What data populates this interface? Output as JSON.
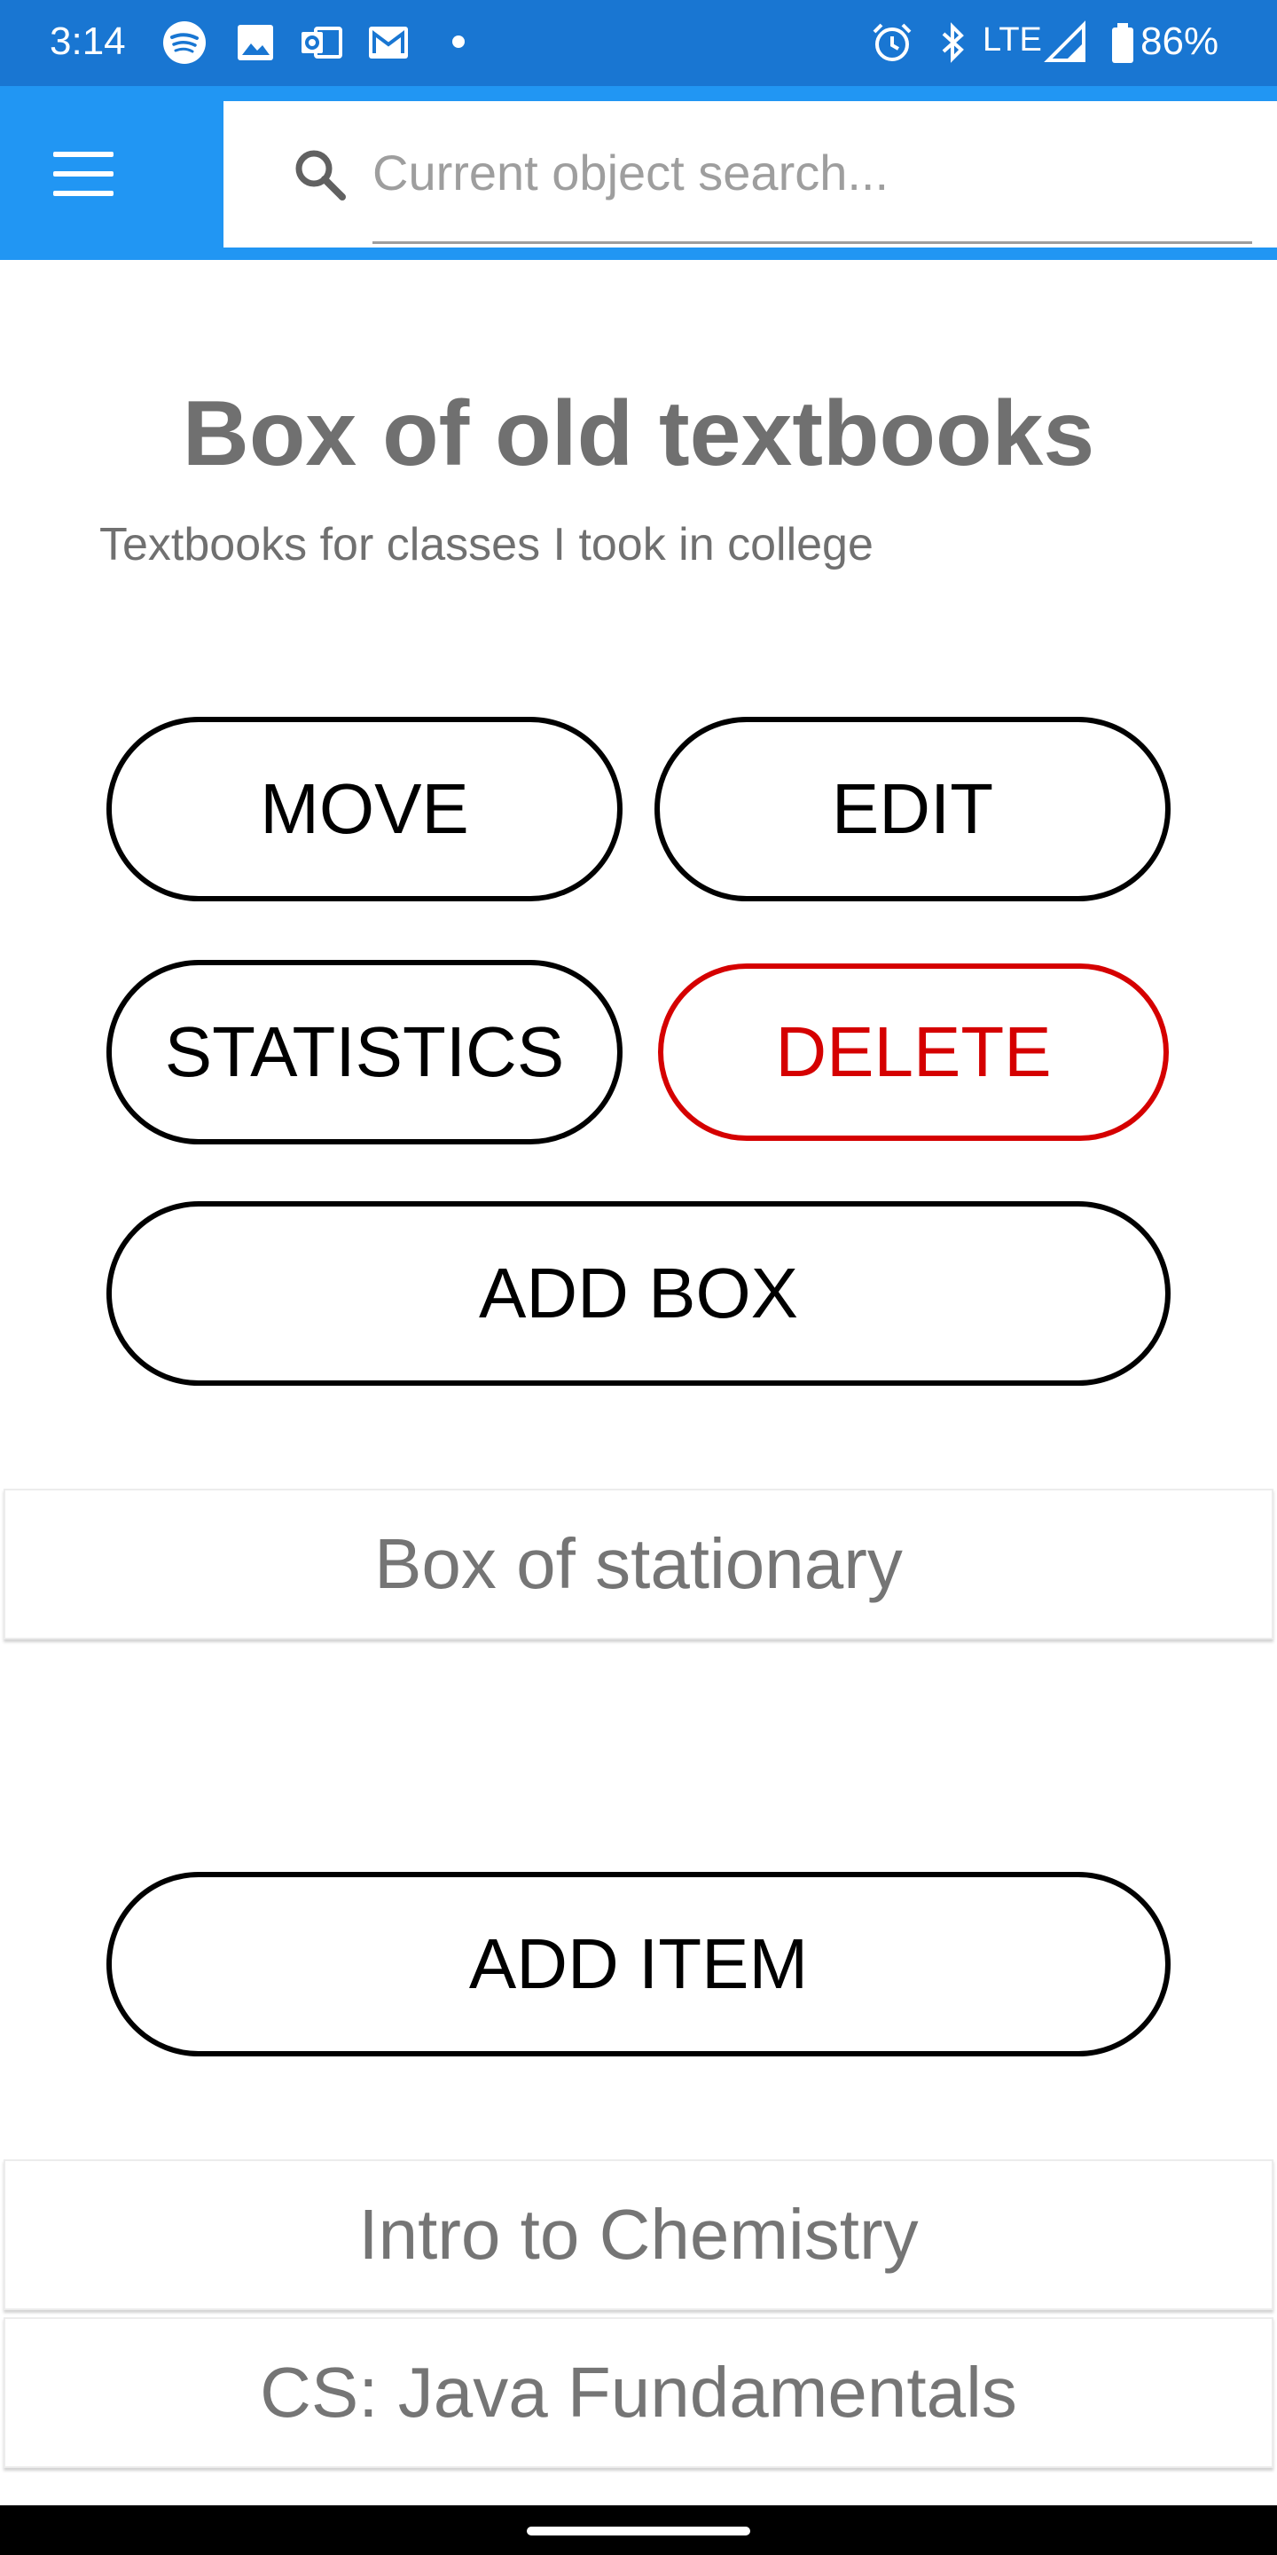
{
  "status_bar": {
    "time": "3:14",
    "network": "LTE",
    "battery_percent": "86%",
    "icons_left": [
      "spotify-icon",
      "image-icon",
      "outlook-icon",
      "gmail-icon"
    ],
    "icons_right": [
      "alarm-icon",
      "bluetooth-icon",
      "signal-icon",
      "battery-icon"
    ]
  },
  "app_bar": {
    "menu_icon": "hamburger-menu-icon",
    "search_placeholder": "Current object search...",
    "search_value": ""
  },
  "box": {
    "title": "Box of old textbooks",
    "description": "Textbooks for classes I took in college"
  },
  "actions": {
    "move": "MOVE",
    "edit": "EDIT",
    "statistics": "STATISTICS",
    "delete": "DELETE",
    "add_box": "ADD BOX",
    "add_item": "ADD ITEM"
  },
  "boxes": [
    "Box of stationary"
  ],
  "items": [
    "Intro to Chemistry",
    "CS: Java Fundamentals"
  ],
  "colors": {
    "status_bar": "#1976d2",
    "app_bar": "#2196f3",
    "delete_accent": "#d50000",
    "muted_text": "#707070"
  }
}
